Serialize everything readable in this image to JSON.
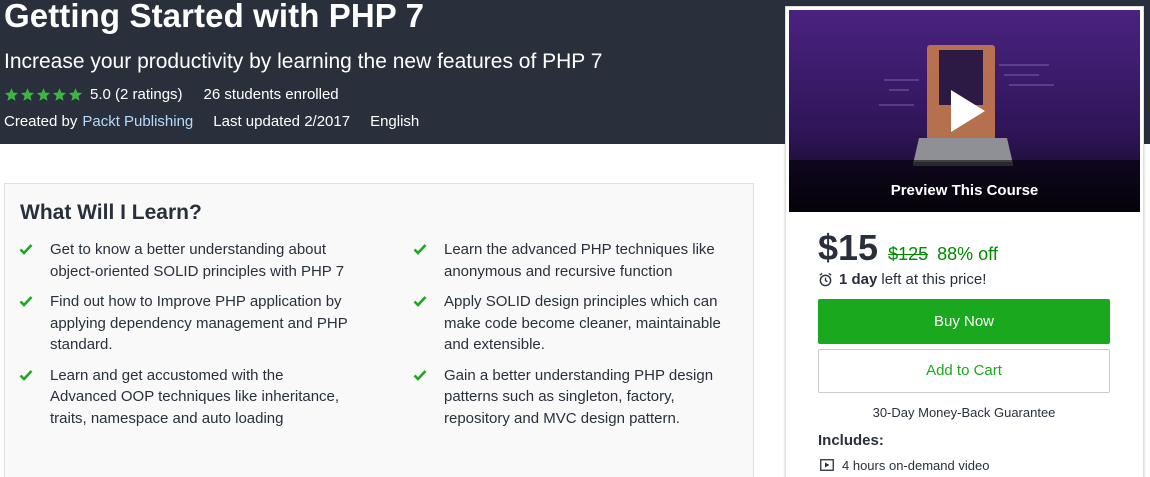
{
  "course": {
    "title": "Getting Started with PHP 7",
    "subtitle": "Increase your productivity by learning the new features of PHP 7",
    "rating_stars": 5,
    "rating_text": "5.0 (2 ratings)",
    "enrolled": "26 students enrolled",
    "created_by_label": "Created by",
    "author": "Packt Publishing",
    "last_updated": "Last updated 2/2017",
    "language": "English"
  },
  "learn": {
    "heading": "What Will I Learn?",
    "items": [
      "Get to know a better understanding about object-oriented SOLID principles with PHP 7",
      "Learn the advanced PHP techniques like anonymous and recursive function",
      "Find out how to Improve PHP application by applying dependency management and PHP standard.",
      "Apply SOLID design principles which can make code become cleaner, maintainable and extensible.",
      "Learn and get accustomed with the Advanced OOP techniques like inheritance, traits, namespace and auto loading",
      "Gain a better understanding PHP design patterns such as singleton, factory, repository and MVC design pattern."
    ]
  },
  "sidebar": {
    "preview_label": "Preview This Course",
    "price": "$15",
    "old_price": "$125",
    "discount": "88% off",
    "timer_bold": "1 day",
    "timer_rest": "left at this price!",
    "buy_now": "Buy Now",
    "add_to_cart": "Add to Cart",
    "guarantee": "30-Day Money-Back Guarantee",
    "includes_title": "Includes:",
    "includes": [
      "4 hours on-demand video"
    ]
  },
  "colors": {
    "hero_bg": "#29303b",
    "accent_green": "#1aa81f",
    "star": "#28a745",
    "link": "#b6dafc",
    "preview_purple": "#3b1c6a"
  },
  "icons": {
    "star": "star-icon",
    "check": "check-icon",
    "play": "play-icon",
    "clock": "alarm-clock-icon",
    "video": "video-icon"
  }
}
